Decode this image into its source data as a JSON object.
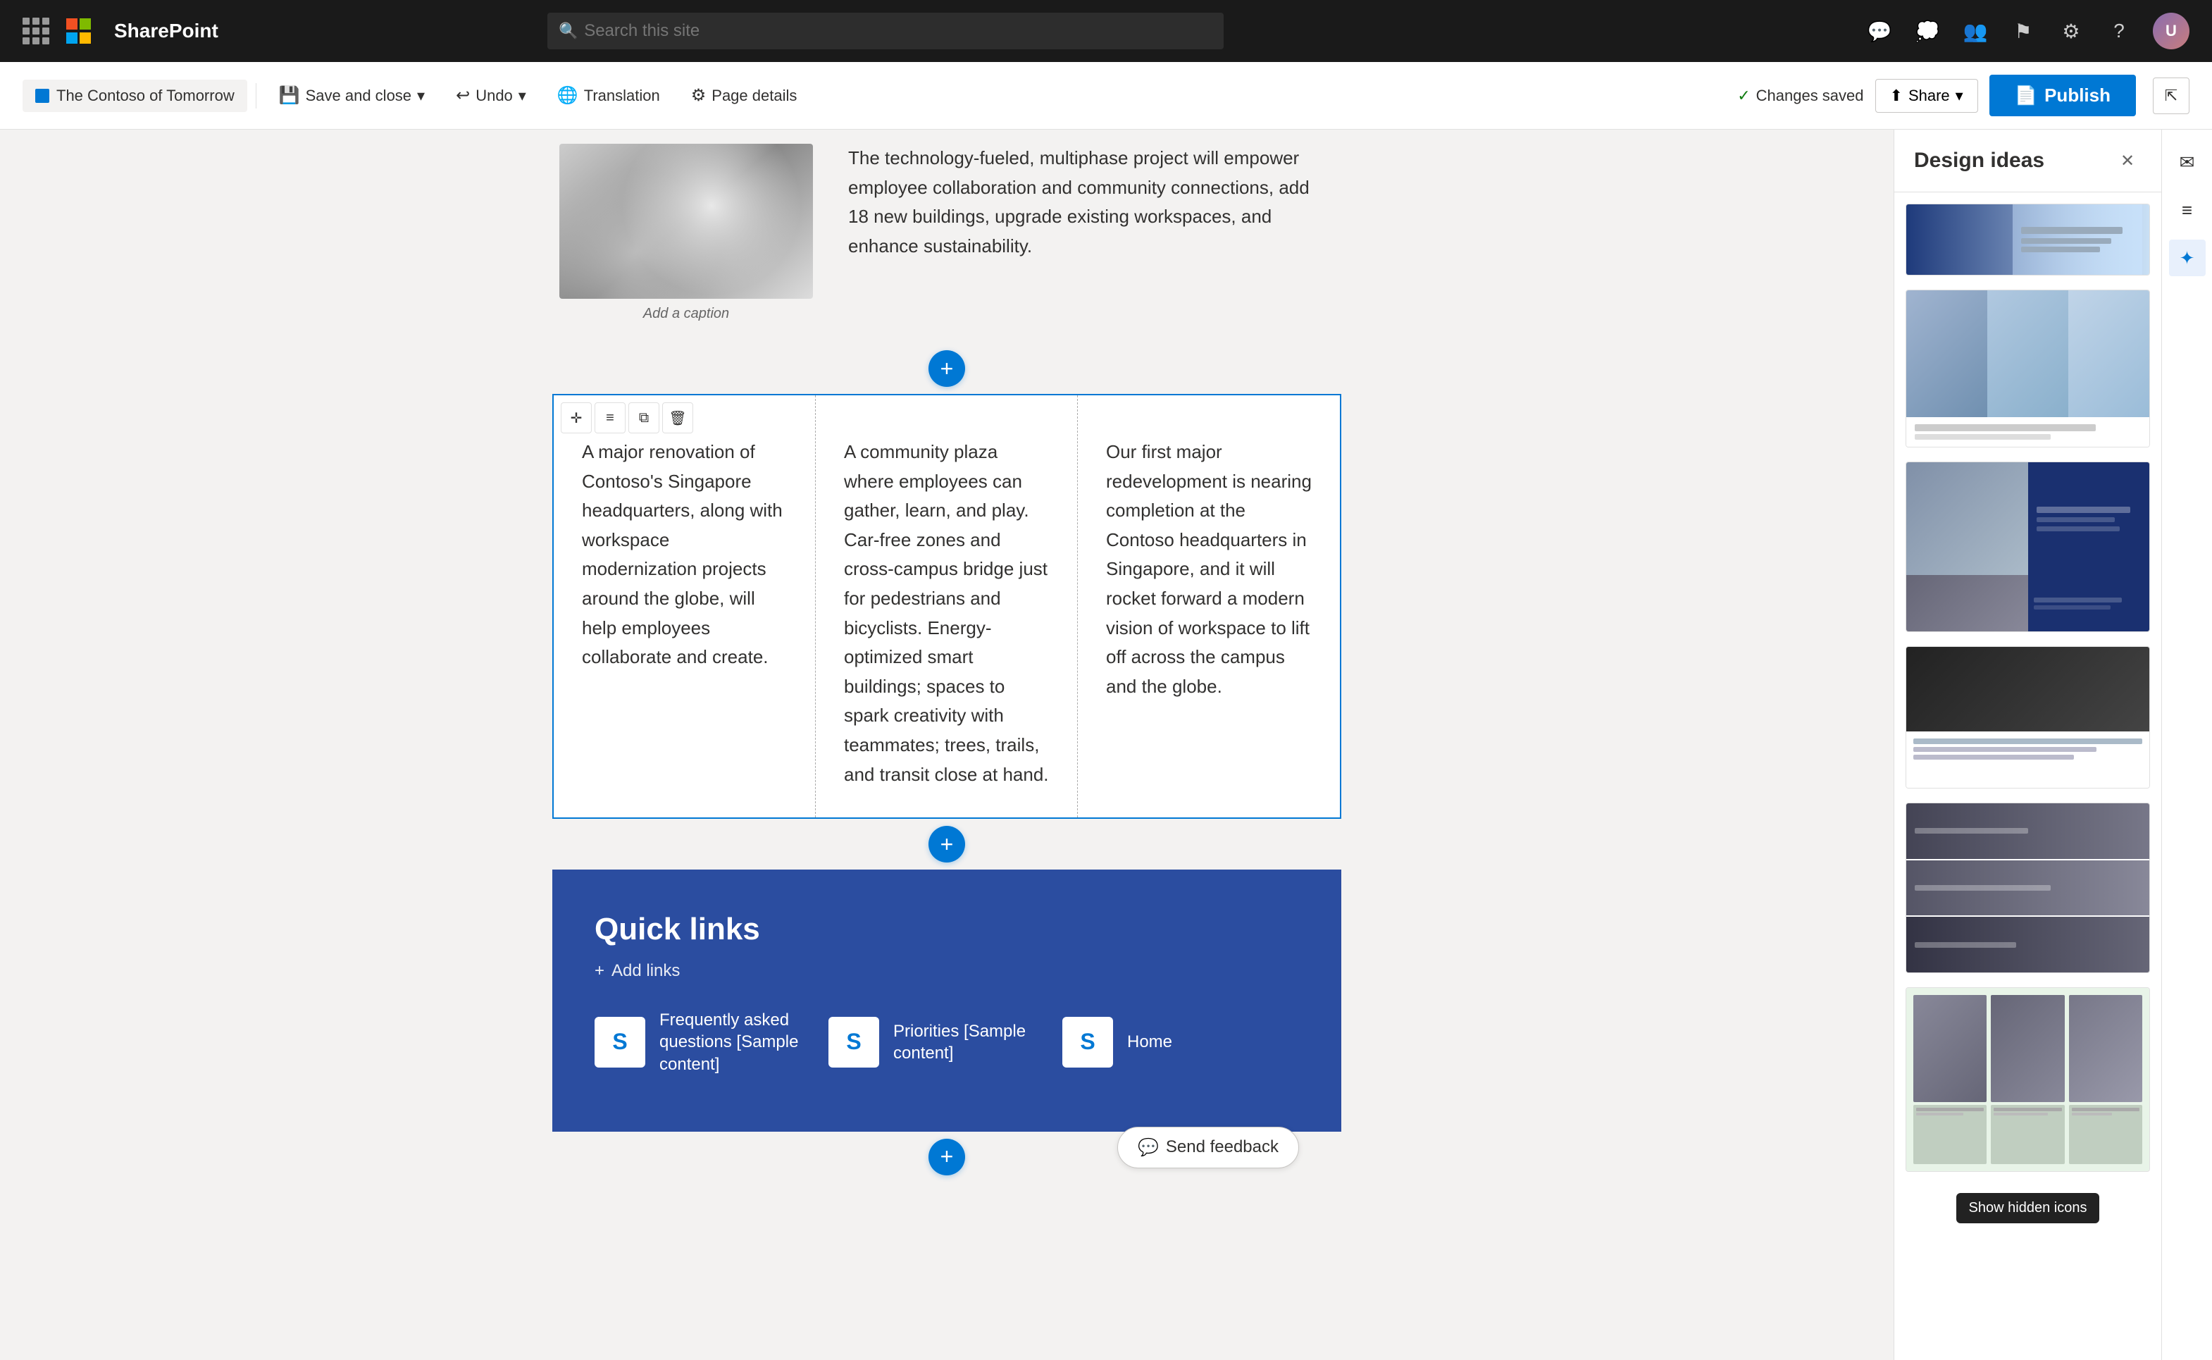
{
  "topnav": {
    "app_name": "SharePoint",
    "search_placeholder": "Search this site",
    "grid_icon": "grid-icon",
    "avatar_initials": "U"
  },
  "toolbar": {
    "site_name": "The Contoso of Tomorrow",
    "save_close": "Save and close",
    "undo": "Undo",
    "translation": "Translation",
    "page_details": "Page details",
    "changes_saved": "Changes saved",
    "share": "Share",
    "publish": "Publish"
  },
  "design_panel": {
    "title": "Design ideas",
    "close_label": "×"
  },
  "page": {
    "intro_paragraph1": "The technology-fueled, multiphase project will empower employee collaboration and community connections, add 18 new buildings, upgrade existing workspaces, and enhance sustainability.",
    "image_caption": "Add a caption",
    "col1_text": "A major renovation of Contoso's Singapore headquarters, along with workspace modernization projects around the globe, will help employees collaborate and create.",
    "col2_text": "A community plaza where employees can gather, learn, and play. Car-free zones and cross-campus bridge just for pedestrians and bicyclists. Energy-optimized smart buildings; spaces to spark creativity with teammates; trees, trails, and transit close at hand.",
    "col3_text": "Our first major redevelopment is nearing completion at the Contoso headquarters in Singapore, and it will rocket forward a modern vision of workspace to lift off across the campus and the globe.",
    "quick_links_title": "Quick links",
    "add_links": "Add links",
    "links": [
      {
        "label": "Frequently asked questions [Sample content]"
      },
      {
        "label": "Priorities [Sample content]"
      },
      {
        "label": "Home"
      }
    ],
    "feedback_label": "Send feedback"
  },
  "tooltip": {
    "show_hidden": "Show hidden icons"
  }
}
